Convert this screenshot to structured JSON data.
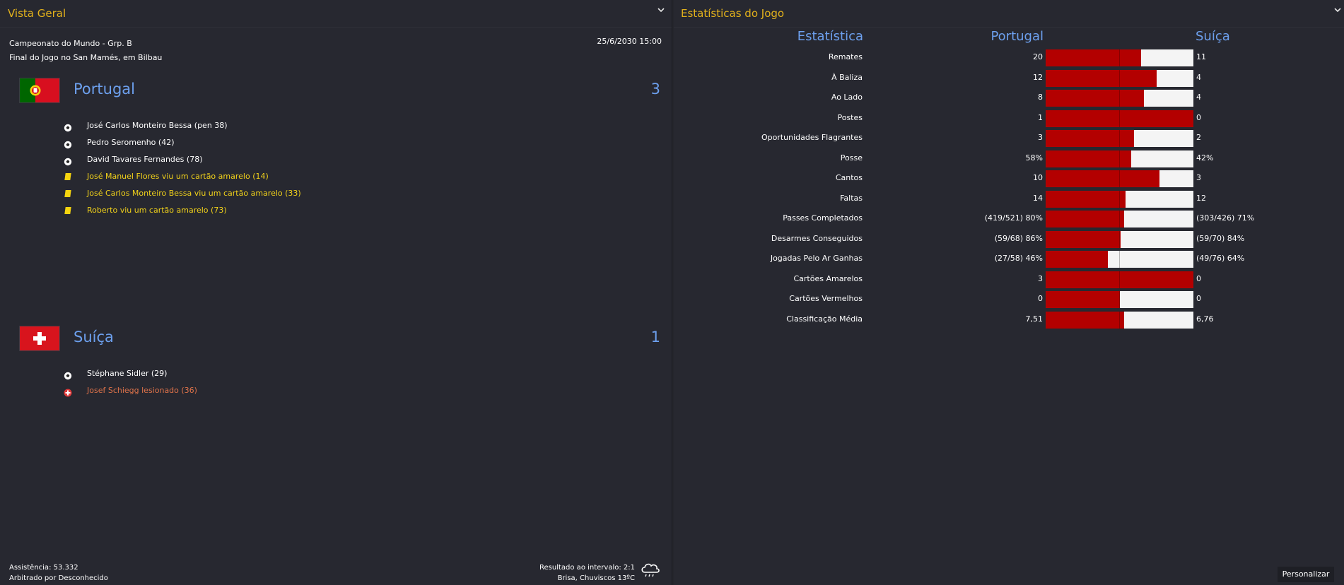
{
  "left_panel": {
    "title": "Vista Geral",
    "competition": "Campeonato do Mundo - Grp. B",
    "venue": "Final do Jogo no San Mamés, em Bilbau",
    "date": "25/6/2030 15:00",
    "home": {
      "name": "Portugal",
      "score": "3",
      "events": [
        {
          "type": "goal-icon",
          "text": "José Carlos Monteiro Bessa (pen 38)"
        },
        {
          "type": "goal-icon",
          "text": "Pedro Seromenho (42)"
        },
        {
          "type": "goal-icon",
          "text": "David Tavares Fernandes (78)"
        },
        {
          "type": "yellow-card-icon",
          "text": "José Manuel Flores viu um cartão amarelo (14)"
        },
        {
          "type": "yellow-card-icon",
          "text": "José Carlos Monteiro Bessa viu um cartão amarelo (33)"
        },
        {
          "type": "yellow-card-icon",
          "text": "Roberto viu um cartão amarelo (73)"
        }
      ]
    },
    "away": {
      "name": "Suíça",
      "score": "1",
      "events": [
        {
          "type": "goal-icon",
          "text": "Stéphane Sidler (29)"
        },
        {
          "type": "injury-icon",
          "text": "Josef Schiegg lesionado (36)"
        }
      ]
    },
    "footer": {
      "attendance": "Assistência: 53.332",
      "referee": "Arbitrado por Desconhecido",
      "halftime": "Resultado ao intervalo: 2:1",
      "weather": "Brisa, Chuviscos 13ºC"
    }
  },
  "right_panel": {
    "title": "Estatísticas do Jogo",
    "headers": {
      "stat": "Estatística",
      "home": "Portugal",
      "away": "Suíça"
    },
    "bar_color_home": "#b30000",
    "bar_color_away": "#f4f4f4",
    "rows": [
      {
        "label": "Remates",
        "home": "20",
        "away": "11",
        "home_share": 0.645
      },
      {
        "label": "À Baliza",
        "home": "12",
        "away": "4",
        "home_share": 0.75
      },
      {
        "label": "Ao Lado",
        "home": "8",
        "away": "4",
        "home_share": 0.667
      },
      {
        "label": "Postes",
        "home": "1",
        "away": "0",
        "home_share": 1.0
      },
      {
        "label": "Oportunidades Flagrantes",
        "home": "3",
        "away": "2",
        "home_share": 0.6
      },
      {
        "label": "Posse",
        "home": "58%",
        "away": "42%",
        "home_share": 0.58
      },
      {
        "label": "Cantos",
        "home": "10",
        "away": "3",
        "home_share": 0.77
      },
      {
        "label": "Faltas",
        "home": "14",
        "away": "12",
        "home_share": 0.54
      },
      {
        "label": "Passes Completados",
        "home": "(419/521) 80%",
        "away": "(303/426) 71%",
        "home_share": 0.53
      },
      {
        "label": "Desarmes Conseguidos",
        "home": "(59/68) 86%",
        "away": "(59/70) 84%",
        "home_share": 0.505
      },
      {
        "label": "Jogadas Pelo Ar Ganhas",
        "home": "(27/58) 46%",
        "away": "(49/76) 64%",
        "home_share": 0.42
      },
      {
        "label": "Cartões Amarelos",
        "home": "3",
        "away": "0",
        "home_share": 1.0
      },
      {
        "label": "Cartões Vermelhos",
        "home": "0",
        "away": "0",
        "home_share": 0.5
      },
      {
        "label": "Classificação Média",
        "home": "7,51",
        "away": "6,76",
        "home_share": 0.53
      }
    ],
    "customize_label": "Personalizar"
  }
}
